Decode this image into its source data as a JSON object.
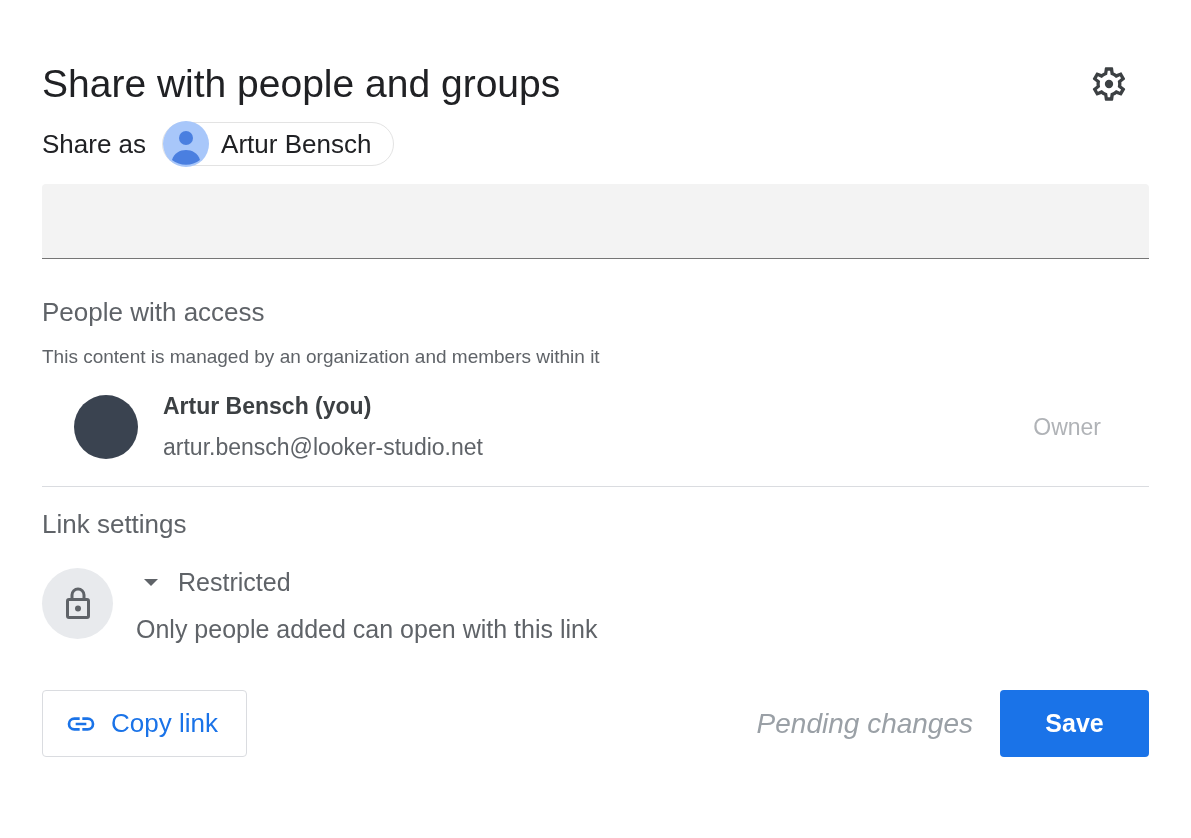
{
  "title": "Share with people and groups",
  "share_as": {
    "label": "Share as",
    "account": "Artur Bensch"
  },
  "people_with_access": {
    "heading": "People with access",
    "note": "This content is managed by an organization and members within it",
    "people": [
      {
        "name": "Artur Bensch (you)",
        "email": "artur.bensch@looker-studio.net",
        "role": "Owner"
      }
    ]
  },
  "link_settings": {
    "heading": "Link settings",
    "access": "Restricted",
    "description": "Only people added can open with this link"
  },
  "footer": {
    "copy_link": "Copy link",
    "status": "Pending changes",
    "save": "Save"
  }
}
